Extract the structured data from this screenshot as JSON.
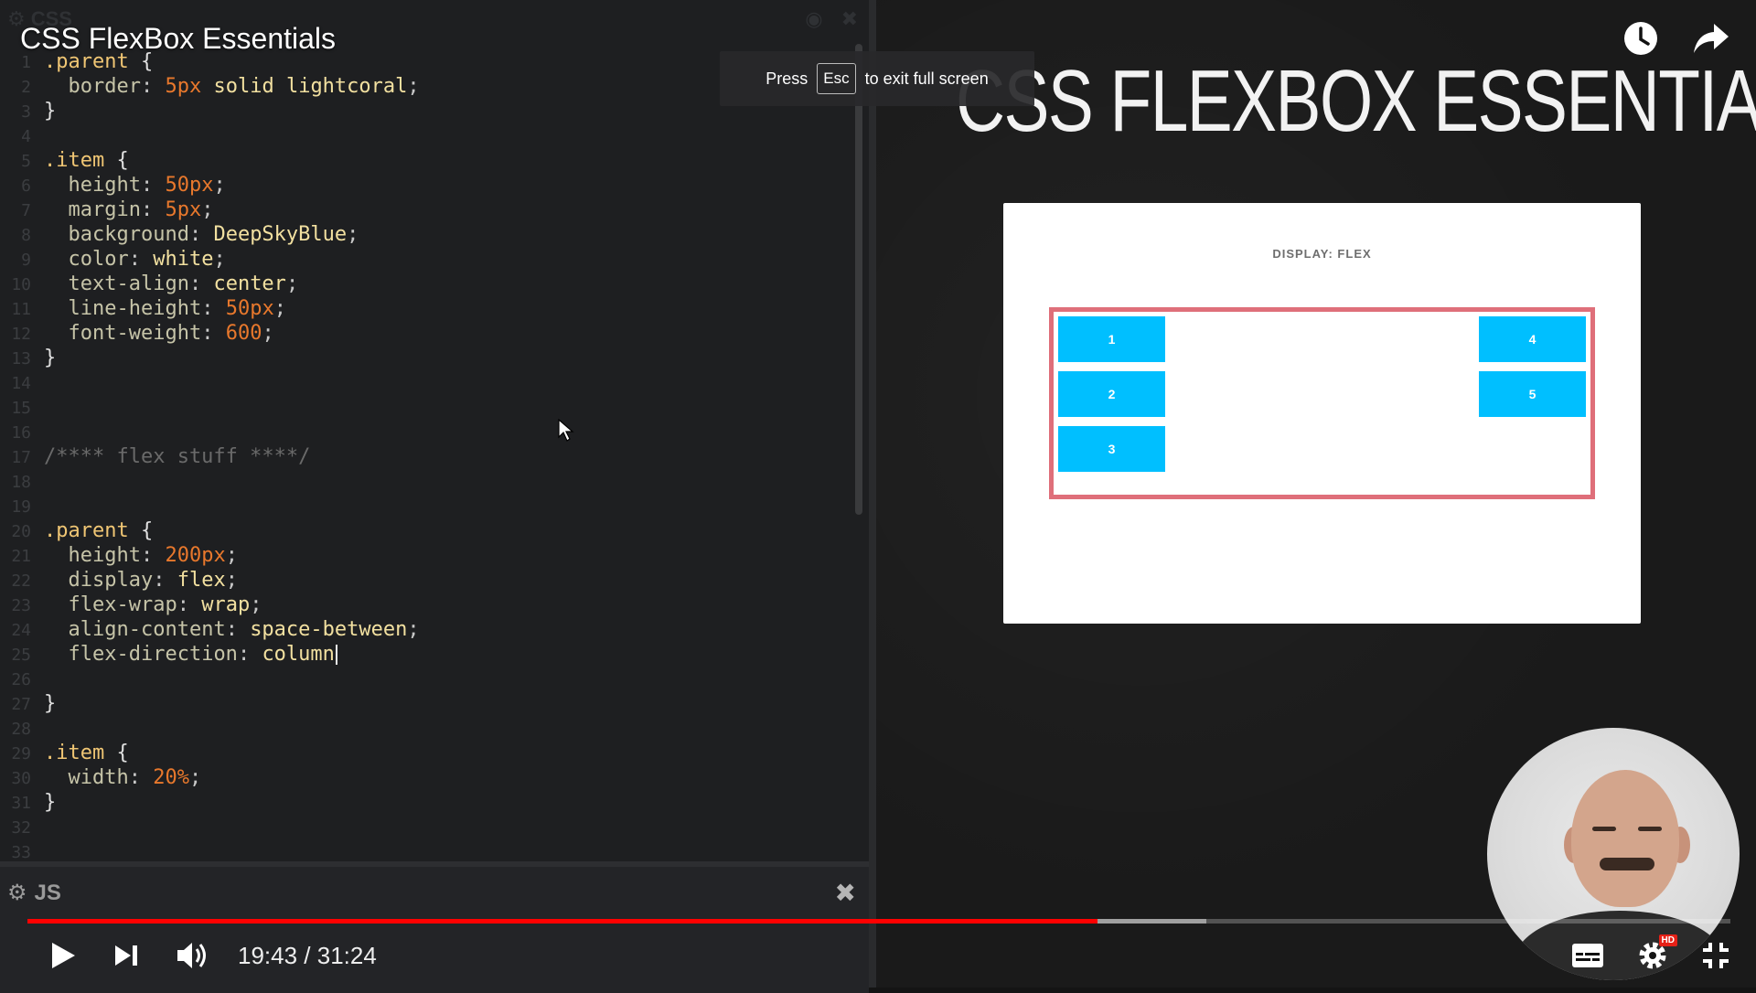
{
  "player": {
    "title": "CSS FlexBox Essentials",
    "fullscreen_toast": {
      "prefix": "Press",
      "key": "Esc",
      "suffix": "to exit full screen"
    },
    "time_current": "19:43",
    "time_total": "31:24",
    "time_display": "19:43 / 31:24",
    "progress": {
      "played_fraction": 0.6284,
      "buffered_fraction": 0.6921
    },
    "hd_badge": "HD",
    "icons": {
      "watch_later": "clock-icon",
      "share": "share-arrow-icon",
      "play": "play-icon",
      "next": "next-icon",
      "volume": "volume-icon",
      "subtitles": "subtitles-icon",
      "settings": "gear-icon",
      "exit_fullscreen": "exit-fullscreen-icon"
    },
    "colors": {
      "progress_played": "#ff0000",
      "hd_badge": "#e62117"
    }
  },
  "editor": {
    "panel_label": "CSS",
    "js_panel_label": "JS",
    "lines": [
      {
        "n": "1",
        "tokens": [
          [
            "sel",
            ".parent"
          ],
          [
            "brace",
            " {"
          ]
        ]
      },
      {
        "n": "2",
        "tokens": [
          [
            "ws",
            "  "
          ],
          [
            "prop",
            "border"
          ],
          [
            "punc",
            ": "
          ],
          [
            "num",
            "5px"
          ],
          [
            "val",
            " solid lightcoral"
          ],
          [
            "punc",
            ";"
          ]
        ]
      },
      {
        "n": "3",
        "tokens": [
          [
            "brace",
            "}"
          ]
        ]
      },
      {
        "n": "4",
        "tokens": []
      },
      {
        "n": "5",
        "tokens": [
          [
            "sel",
            ".item"
          ],
          [
            "brace",
            " {"
          ]
        ]
      },
      {
        "n": "6",
        "tokens": [
          [
            "ws",
            "  "
          ],
          [
            "prop",
            "height"
          ],
          [
            "punc",
            ": "
          ],
          [
            "num",
            "50px"
          ],
          [
            "punc",
            ";"
          ]
        ]
      },
      {
        "n": "7",
        "tokens": [
          [
            "ws",
            "  "
          ],
          [
            "prop",
            "margin"
          ],
          [
            "punc",
            ": "
          ],
          [
            "num",
            "5px"
          ],
          [
            "punc",
            ";"
          ]
        ]
      },
      {
        "n": "8",
        "tokens": [
          [
            "ws",
            "  "
          ],
          [
            "prop",
            "background"
          ],
          [
            "punc",
            ": "
          ],
          [
            "val",
            "DeepSkyBlue"
          ],
          [
            "punc",
            ";"
          ]
        ]
      },
      {
        "n": "9",
        "tokens": [
          [
            "ws",
            "  "
          ],
          [
            "prop",
            "color"
          ],
          [
            "punc",
            ": "
          ],
          [
            "val",
            "white"
          ],
          [
            "punc",
            ";"
          ]
        ]
      },
      {
        "n": "10",
        "tokens": [
          [
            "ws",
            "  "
          ],
          [
            "prop",
            "text-align"
          ],
          [
            "punc",
            ": "
          ],
          [
            "val",
            "center"
          ],
          [
            "punc",
            ";"
          ]
        ]
      },
      {
        "n": "11",
        "tokens": [
          [
            "ws",
            "  "
          ],
          [
            "prop",
            "line-height"
          ],
          [
            "punc",
            ": "
          ],
          [
            "num",
            "50px"
          ],
          [
            "punc",
            ";"
          ]
        ]
      },
      {
        "n": "12",
        "tokens": [
          [
            "ws",
            "  "
          ],
          [
            "prop",
            "font-weight"
          ],
          [
            "punc",
            ": "
          ],
          [
            "num",
            "600"
          ],
          [
            "punc",
            ";"
          ]
        ]
      },
      {
        "n": "13",
        "tokens": [
          [
            "brace",
            "}"
          ]
        ]
      },
      {
        "n": "14",
        "tokens": []
      },
      {
        "n": "15",
        "tokens": []
      },
      {
        "n": "16",
        "tokens": []
      },
      {
        "n": "17",
        "tokens": [
          [
            "comment",
            "/**** flex stuff ****/"
          ]
        ]
      },
      {
        "n": "18",
        "tokens": []
      },
      {
        "n": "19",
        "tokens": []
      },
      {
        "n": "20",
        "tokens": [
          [
            "sel",
            ".parent"
          ],
          [
            "brace",
            " {"
          ]
        ]
      },
      {
        "n": "21",
        "tokens": [
          [
            "ws",
            "  "
          ],
          [
            "prop",
            "height"
          ],
          [
            "punc",
            ": "
          ],
          [
            "num",
            "200px"
          ],
          [
            "punc",
            ";"
          ]
        ]
      },
      {
        "n": "22",
        "tokens": [
          [
            "ws",
            "  "
          ],
          [
            "prop",
            "display"
          ],
          [
            "punc",
            ": "
          ],
          [
            "val",
            "flex"
          ],
          [
            "punc",
            ";"
          ]
        ]
      },
      {
        "n": "23",
        "tokens": [
          [
            "ws",
            "  "
          ],
          [
            "prop",
            "flex-wrap"
          ],
          [
            "punc",
            ": "
          ],
          [
            "val",
            "wrap"
          ],
          [
            "punc",
            ";"
          ]
        ]
      },
      {
        "n": "24",
        "tokens": [
          [
            "ws",
            "  "
          ],
          [
            "prop",
            "align-content"
          ],
          [
            "punc",
            ": "
          ],
          [
            "val",
            "space-between"
          ],
          [
            "punc",
            ";"
          ]
        ]
      },
      {
        "n": "25",
        "tokens": [
          [
            "ws",
            "  "
          ],
          [
            "prop",
            "flex-direction"
          ],
          [
            "punc",
            ": "
          ],
          [
            "val",
            "column"
          ],
          [
            "cursor",
            ""
          ]
        ]
      },
      {
        "n": "26",
        "tokens": []
      },
      {
        "n": "27",
        "tokens": [
          [
            "brace",
            "}"
          ]
        ]
      },
      {
        "n": "28",
        "tokens": []
      },
      {
        "n": "29",
        "tokens": [
          [
            "sel",
            ".item"
          ],
          [
            "brace",
            " {"
          ]
        ]
      },
      {
        "n": "30",
        "tokens": [
          [
            "ws",
            "  "
          ],
          [
            "prop",
            "width"
          ],
          [
            "punc",
            ": "
          ],
          [
            "num",
            "20%"
          ],
          [
            "punc",
            ";"
          ]
        ]
      },
      {
        "n": "31",
        "tokens": [
          [
            "brace",
            "}"
          ]
        ]
      },
      {
        "n": "32",
        "tokens": []
      },
      {
        "n": "33",
        "tokens": []
      }
    ]
  },
  "slide": {
    "heading": "CSS FLEXBOX ESSENTIALS",
    "demo_label": "DISPLAY: FLEX",
    "items": [
      "1",
      "2",
      "3",
      "4",
      "5"
    ],
    "colors": {
      "item_bg": "#00bfff",
      "parent_border": "#df6f7a"
    }
  }
}
